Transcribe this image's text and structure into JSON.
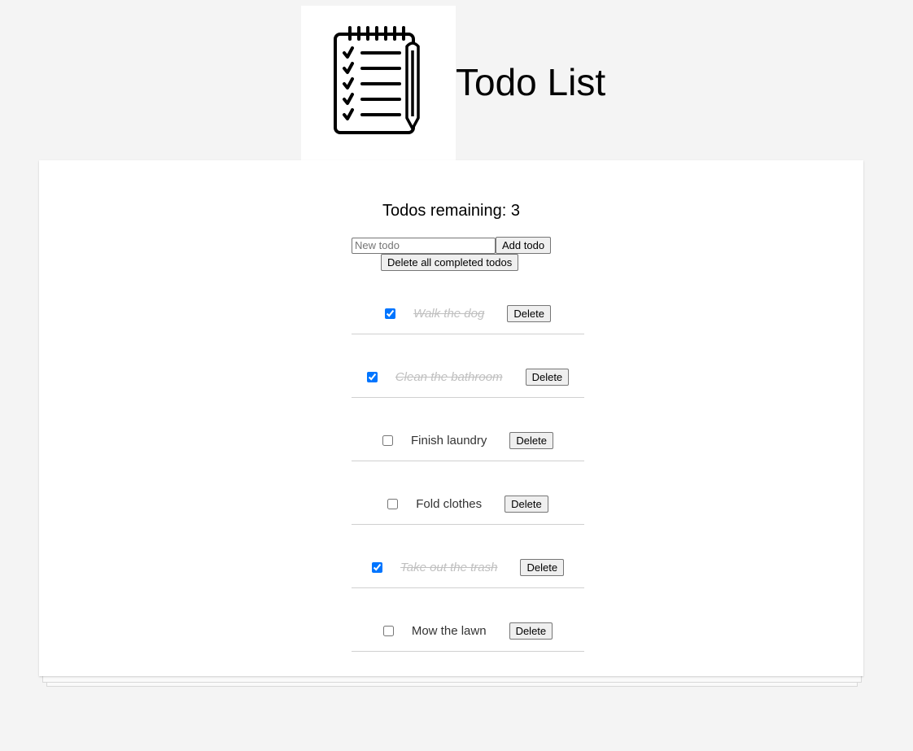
{
  "header": {
    "title": "Todo List",
    "logo_icon": "notepad-checklist-icon"
  },
  "summary": {
    "remaining_text": "Todos remaining: 3"
  },
  "form": {
    "input_placeholder": "New todo",
    "input_value": "",
    "add_label": "Add todo",
    "delete_completed_label": "Delete all completed todos"
  },
  "todos": [
    {
      "text": "Walk the dog",
      "done": true,
      "delete_label": "Delete"
    },
    {
      "text": "Clean the bathroom",
      "done": true,
      "delete_label": "Delete"
    },
    {
      "text": "Finish laundry",
      "done": false,
      "delete_label": "Delete"
    },
    {
      "text": "Fold clothes",
      "done": false,
      "delete_label": "Delete"
    },
    {
      "text": "Take out the trash",
      "done": true,
      "delete_label": "Delete"
    },
    {
      "text": "Mow the lawn",
      "done": false,
      "delete_label": "Delete"
    }
  ],
  "colors": {
    "background": "#f4f4f4",
    "card": "#ffffff",
    "checkbox_accent": "#0075ff",
    "completed_text": "#c0c0c0"
  }
}
